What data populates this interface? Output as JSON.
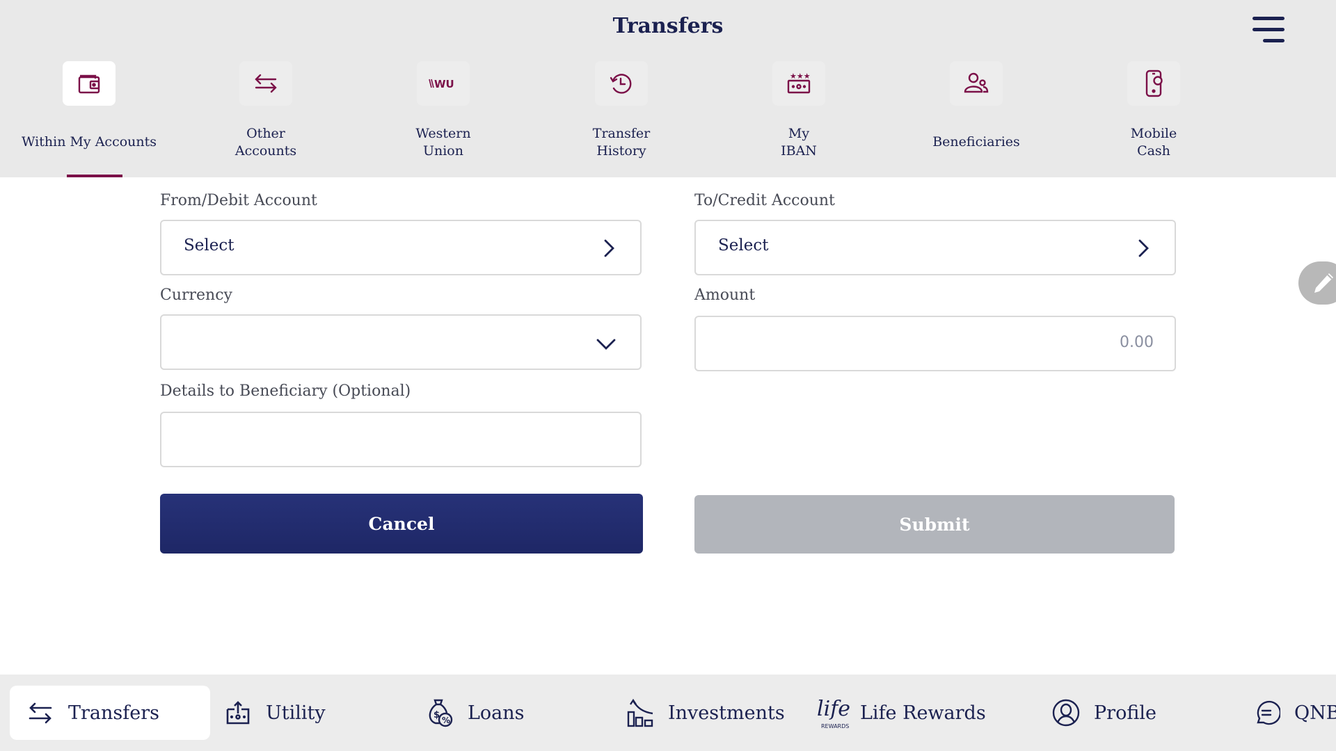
{
  "header": {
    "title": "Transfers",
    "menu_icon": "hamburger-menu-icon"
  },
  "tabs": [
    {
      "id": "within-my-accounts",
      "label": "Within My Accounts",
      "icon": "wallet-icon",
      "active": true
    },
    {
      "id": "other-accounts",
      "label": "Other\nAccounts",
      "icon": "swap-arrows-icon",
      "active": false
    },
    {
      "id": "western-union",
      "label": "Western\nUnion",
      "icon": "western-union-logo-icon",
      "icon_text": "WU",
      "active": false
    },
    {
      "id": "transfer-history",
      "label": "Transfer\nHistory",
      "icon": "history-clock-icon",
      "active": false
    },
    {
      "id": "my-iban",
      "label": "My\nIBAN",
      "icon": "iban-card-icon",
      "active": false
    },
    {
      "id": "beneficiaries",
      "label": "Beneficiaries",
      "icon": "users-icon",
      "active": false
    },
    {
      "id": "mobile-cash",
      "label": "Mobile\nCash",
      "icon": "mobile-cash-icon",
      "active": false
    }
  ],
  "form": {
    "from_account": {
      "label": "From/Debit Account",
      "value": "Select"
    },
    "to_account": {
      "label": "To/Credit Account",
      "value": "Select"
    },
    "currency": {
      "label": "Currency",
      "value": ""
    },
    "amount": {
      "label": "Amount",
      "placeholder": "0.00",
      "value": ""
    },
    "details": {
      "label": "Details to Beneficiary (Optional)",
      "value": ""
    },
    "cancel_label": "Cancel",
    "submit_label": "Submit",
    "submit_enabled": false
  },
  "edit_fab": {
    "icon": "pencil-icon"
  },
  "bottom_nav": [
    {
      "id": "transfers",
      "label": "Transfers",
      "icon": "swap-arrows-icon",
      "active": true
    },
    {
      "id": "utility",
      "label": "Utility",
      "icon": "utility-bill-icon",
      "active": false
    },
    {
      "id": "loans",
      "label": "Loans",
      "icon": "money-bag-icon",
      "active": false
    },
    {
      "id": "investments",
      "label": "Investments",
      "icon": "growth-chart-icon",
      "active": false
    },
    {
      "id": "life-rewards",
      "label": "Life Rewards",
      "icon": "life-rewards-logo-icon",
      "icon_text": "life",
      "icon_subtext": "REWARDS",
      "active": false
    },
    {
      "id": "profile",
      "label": "Profile",
      "icon": "profile-icon",
      "active": false
    },
    {
      "id": "qnb-chat",
      "label": "QNB",
      "icon": "chat-icon",
      "active": false
    }
  ],
  "colors": {
    "accent": "#7b1048",
    "primary": "#1b2150",
    "button_primary": "#273278",
    "button_disabled": "#b2b5bb",
    "header_bg": "#e9e9e9"
  }
}
